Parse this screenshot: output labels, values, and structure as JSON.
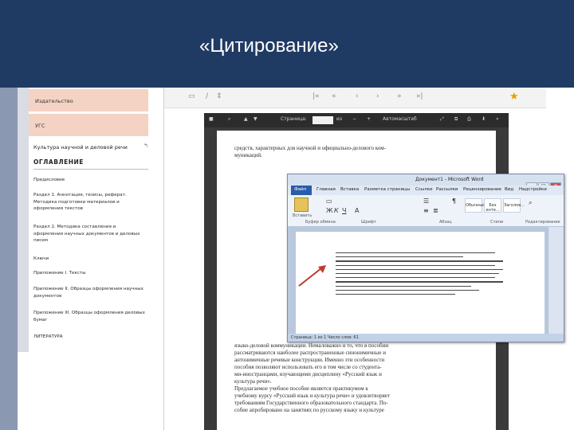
{
  "slide": {
    "title": "«Цитирование»"
  },
  "sidebar": {
    "tabs": [
      "Издательство",
      "УГС"
    ],
    "course_link": "Культура научной и деловой речи",
    "toc_title": "ОГЛАВЛЕНИЕ",
    "toc_items": [
      "Предисловие",
      "Раздел 1. Аннотация, тезисы, реферат. Методика подготовки материалов и оформления текстов",
      "Раздел 2. Методика составления и оформления научных документов и деловых писем",
      "Ключи",
      "Приложение I. Тексты",
      "Приложение II. Образцы оформления научных документов",
      "Приложение III. Образцы оформления деловых бумаг",
      "ЛИТЕРАТУРА"
    ]
  },
  "viewer": {
    "page_input": "/",
    "toolbar_labels": [
      "Страница:",
      "из",
      "Автомасштаб"
    ],
    "page_text_snippets": [
      "средств, характерных для научной и официально-делового ком-",
      "муникаций.",
      "языко-деловой коммуникации. Немаловажно и то, что в пособии",
      "рассматриваются наиболее распространенные синонимичные и",
      "антонимичные речевые конструкции. Именно эти особенности",
      "пособия позволяют использовать его в том числе со студента-",
      "ми-иностранцами, изучающими дисциплину «Русский язык и",
      "культура речи».",
      "Предлагаемое учебное пособие является практикумом к",
      "учебному курсу «Русский язык и культура речи» и удовлетворяет",
      "требованиям Государственного образовательного стандарта. По-",
      "собие апробировано на занятиях по русскому языку и культуре"
    ]
  },
  "word": {
    "title": "Документ1 - Microsoft Word",
    "tabs": [
      "Файл",
      "Главная",
      "Вставка",
      "Разметка страницы",
      "Ссылки",
      "Рассылки",
      "Рецензирование",
      "Вид",
      "Надстройки"
    ],
    "groups": [
      "Буфер обмена",
      "Шрифт",
      "Абзац",
      "Стили",
      "Редактирование"
    ],
    "paste_label": "Вставить",
    "styles": [
      "Обычный",
      "Без инте...",
      "Заголов..."
    ],
    "status": "Страница: 1 из 1   Число слов: 61"
  },
  "colors": {
    "title_band": "#1f3b63",
    "sidebar_tab": "#f4d3c4",
    "arrow": "#c0392b"
  }
}
